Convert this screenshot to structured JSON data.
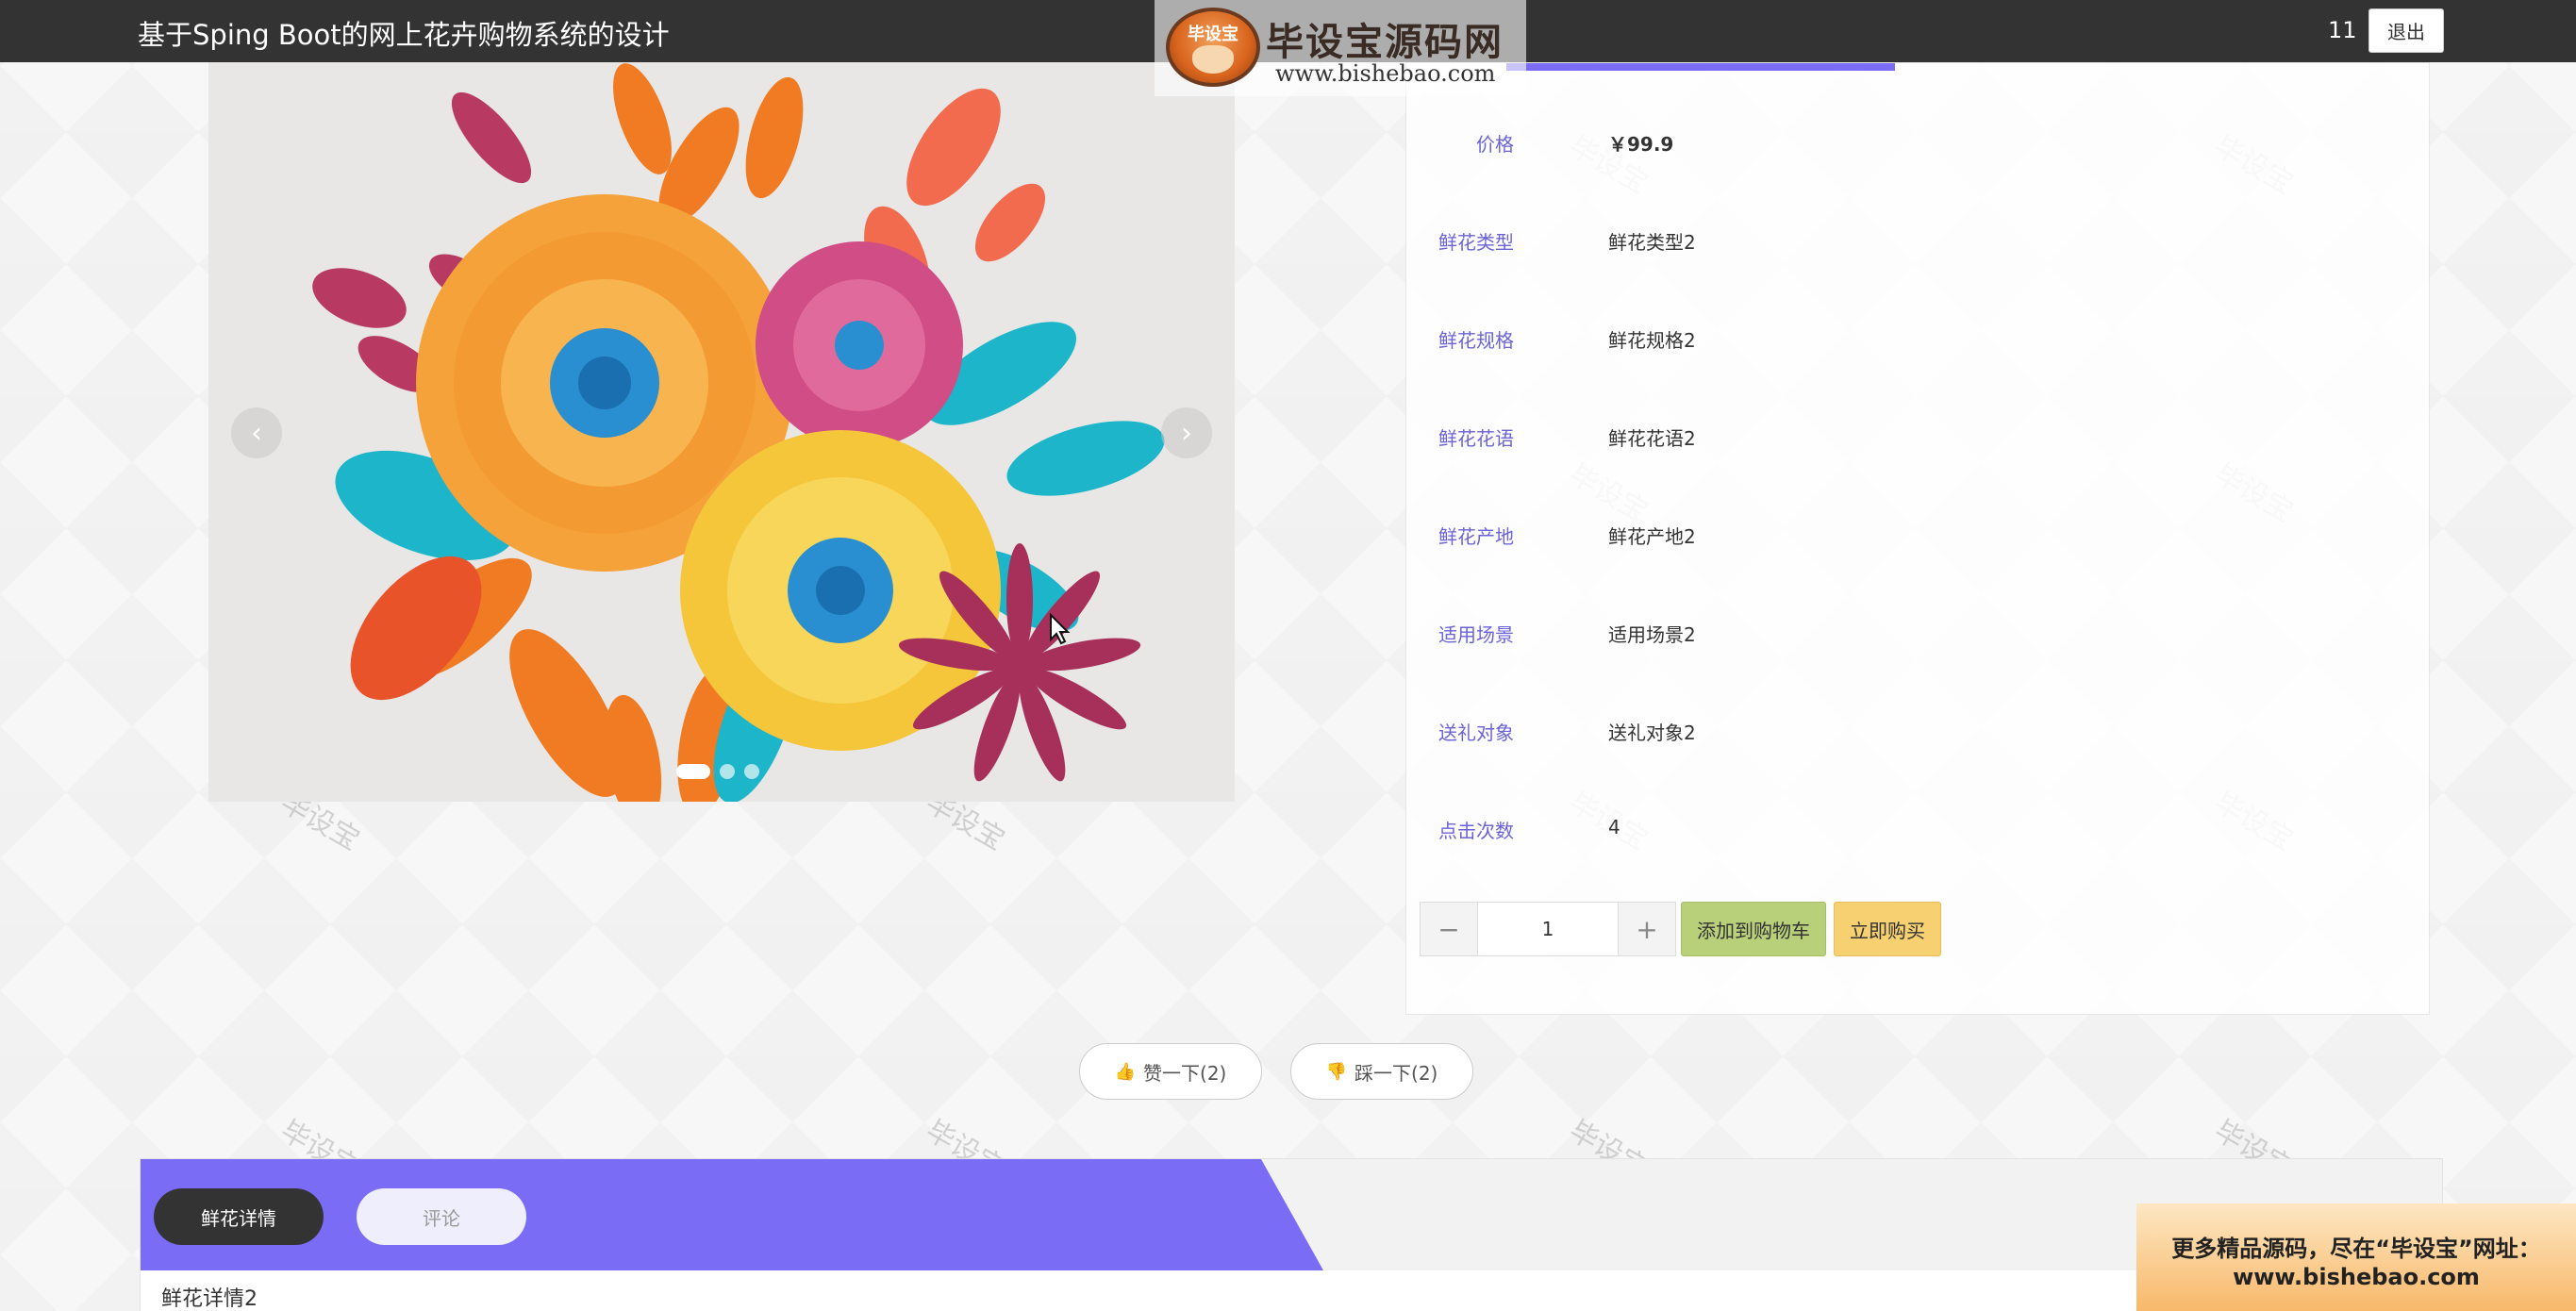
{
  "header": {
    "site_title": "基于Sping Boot的网上花卉购物系统的设计",
    "user_id": "11",
    "logout_label": "退出"
  },
  "overlay_logo": {
    "badge_text": "毕设宝",
    "title": "毕设宝源码网",
    "url": "www.bishebao.com"
  },
  "carousel": {
    "prev_label": "‹",
    "next_label": "›",
    "slide_count": 3,
    "active_slide": 0
  },
  "product": {
    "fields": [
      {
        "label": "价格",
        "value": "￥99.9"
      },
      {
        "label": "鲜花类型",
        "value": "鲜花类型2"
      },
      {
        "label": "鲜花规格",
        "value": "鲜花规格2"
      },
      {
        "label": "鲜花花语",
        "value": "鲜花花语2"
      },
      {
        "label": "鲜花产地",
        "value": "鲜花产地2"
      },
      {
        "label": "适用场景",
        "value": "适用场景2"
      },
      {
        "label": "送礼对象",
        "value": "送礼对象2"
      },
      {
        "label": "点击次数",
        "value": "4"
      }
    ],
    "quantity": "1",
    "minus_label": "−",
    "plus_label": "+",
    "add_to_cart_label": "添加到购物车",
    "buy_now_label": "立即购买"
  },
  "votes": {
    "like_label": "赞一下(2)",
    "dislike_label": "踩一下(2)"
  },
  "tabs": {
    "items": [
      {
        "label": "鲜花详情",
        "active": true
      },
      {
        "label": "评论",
        "active": false
      }
    ],
    "content_text": "鲜花详情2"
  },
  "promo": {
    "line1": "更多精品源码，尽在“毕设宝”网址：",
    "line2": "www.bishebao.com"
  },
  "watermark_text": "毕设宝",
  "colors": {
    "topbar": "#333333",
    "accent": "#7b6cf6",
    "cart_button": "#b8d07a",
    "buy_button": "#f6d071"
  }
}
